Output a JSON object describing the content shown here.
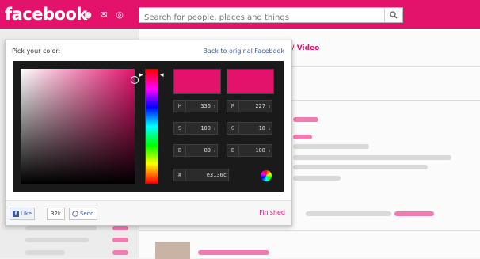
{
  "app": {
    "brand": "facebook"
  },
  "search": {
    "placeholder": "Search for people, places and things"
  },
  "background": {
    "tab_label": "ia / Video"
  },
  "picker": {
    "title": "Pick your color:",
    "back_link": "Back to original Facebook",
    "fields": {
      "h": {
        "label": "H",
        "value": "336"
      },
      "r": {
        "label": "R",
        "value": "227"
      },
      "s": {
        "label": "S",
        "value": "100"
      },
      "g": {
        "label": "G",
        "value": "18"
      },
      "b": {
        "label": "B",
        "value": "89"
      },
      "bl": {
        "label": "B",
        "value": "108"
      },
      "hex": {
        "label": "#",
        "value": "e3136c"
      }
    },
    "finished_label": "Finished"
  },
  "social": {
    "like_label": "Like",
    "like_count": "32k",
    "send_label": "Send"
  },
  "colors": {
    "accent": "#e3136c",
    "link": "#3b5998"
  },
  "icons": [
    "friends-icon",
    "messages-icon",
    "globe-icon",
    "search-icon",
    "color-wheel-icon"
  ]
}
